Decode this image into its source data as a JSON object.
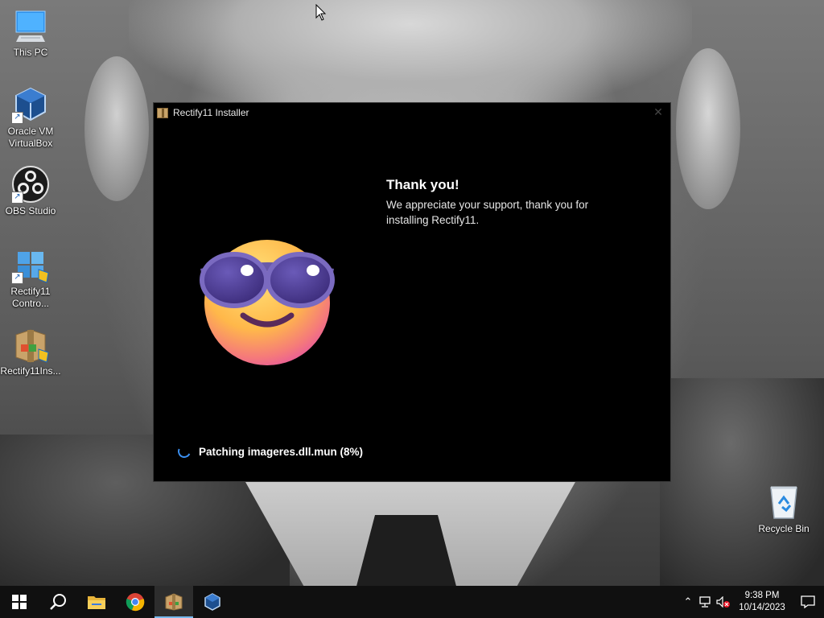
{
  "desktop": {
    "icons": [
      {
        "label": "This PC",
        "icon": "computer-icon"
      },
      {
        "label": "Oracle VM VirtualBox",
        "icon": "virtualbox-icon"
      },
      {
        "label": "OBS Studio",
        "icon": "obs-icon"
      },
      {
        "label": "Rectify11 Contro...",
        "icon": "rectify11-control-icon"
      },
      {
        "label": "Rectify11Ins...",
        "icon": "installer-package-icon"
      }
    ],
    "recycle_bin": {
      "label": "Recycle Bin",
      "icon": "recycle-bin-icon"
    }
  },
  "installer": {
    "title": "Rectify11 Installer",
    "heading": "Thank you!",
    "message": "We appreciate your support, thank you for installing Rectify11.",
    "progress_text": "Patching imageres.dll.mun (8%)",
    "progress_percent": 8,
    "emoji": "smiling-face-with-sunglasses-icon",
    "accent": "#3b8ff0"
  },
  "taskbar": {
    "items": [
      {
        "name": "start-button",
        "icon": "windows-icon"
      },
      {
        "name": "search-button",
        "icon": "search-icon"
      },
      {
        "name": "file-explorer-button",
        "icon": "folder-icon"
      },
      {
        "name": "chrome-button",
        "icon": "chrome-icon"
      },
      {
        "name": "installer-taskbar-button",
        "icon": "installer-package-icon",
        "active": true
      },
      {
        "name": "virtualbox-taskbar-button",
        "icon": "virtualbox-icon"
      }
    ],
    "clock": {
      "time": "9:38 PM",
      "date": "10/14/2023"
    }
  }
}
